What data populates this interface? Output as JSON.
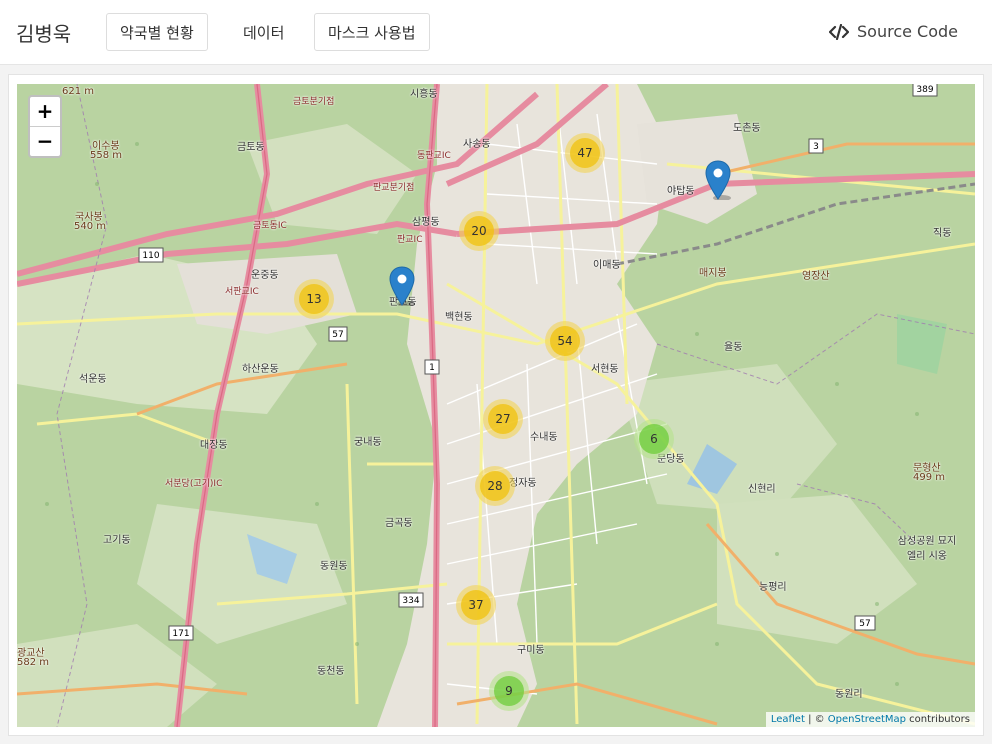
{
  "navbar": {
    "brand": "김병욱",
    "buttons": [
      "약국별 현황",
      "데이터",
      "마스크 사용법"
    ],
    "source_label": "Source Code"
  },
  "map": {
    "zoom_in": "+",
    "zoom_out": "−",
    "clusters": [
      {
        "count": "47",
        "size": "medium"
      },
      {
        "count": "20",
        "size": "medium"
      },
      {
        "count": "13",
        "size": "medium"
      },
      {
        "count": "54",
        "size": "medium"
      },
      {
        "count": "27",
        "size": "medium"
      },
      {
        "count": "6",
        "size": "small"
      },
      {
        "count": "28",
        "size": "medium"
      },
      {
        "count": "37",
        "size": "medium"
      },
      {
        "count": "9",
        "size": "small"
      }
    ],
    "markers": 2,
    "labels": {
      "l1": "시흥동",
      "l2": "사송동",
      "l3": "금토동",
      "l4": "도촌동",
      "l5": "야탑동",
      "l6": "삼평동",
      "l7": "이매동",
      "l8": "운중동",
      "l9": "백현동",
      "l10": "석운동",
      "l11": "하산운동",
      "l12": "대장동",
      "l13": "궁내동",
      "l14": "수내동",
      "l15": "서현동",
      "l16": "율동",
      "l17": "신현리",
      "l18": "금곡동",
      "l19": "정자동",
      "l20": "고기동",
      "l21": "동원동",
      "l22": "구미동",
      "l23": "동천동",
      "l24": "능평리",
      "l25": "동원리",
      "l26": "직동",
      "l27": "이수봉",
      "l28": "558 m",
      "l29": "국사봉",
      "l30": "540 m",
      "l31": "문형산",
      "l32": "499 m",
      "l33": "삼성공원 묘지 엘리 시옹",
      "l34": "판교동",
      "l35": "매지봉",
      "l36": "영장산",
      "l37": "621 m",
      "l38": "광교산",
      "l39": "582 m",
      "l40": "판교IC",
      "l41": "서판교IC",
      "l42": "서분당(고기)IC",
      "l43": "동판교IC",
      "l44": "금토동IC",
      "l45": "판교분기점",
      "l46": "금토분기점",
      "l47": "문당동"
    },
    "shields": [
      "110",
      "57",
      "1",
      "334",
      "171",
      "57",
      "3",
      "389"
    ],
    "attribution": {
      "leaflet": "Leaflet",
      "sep": " | © ",
      "osm": "OpenStreetMap",
      "suffix": " contributors"
    }
  }
}
